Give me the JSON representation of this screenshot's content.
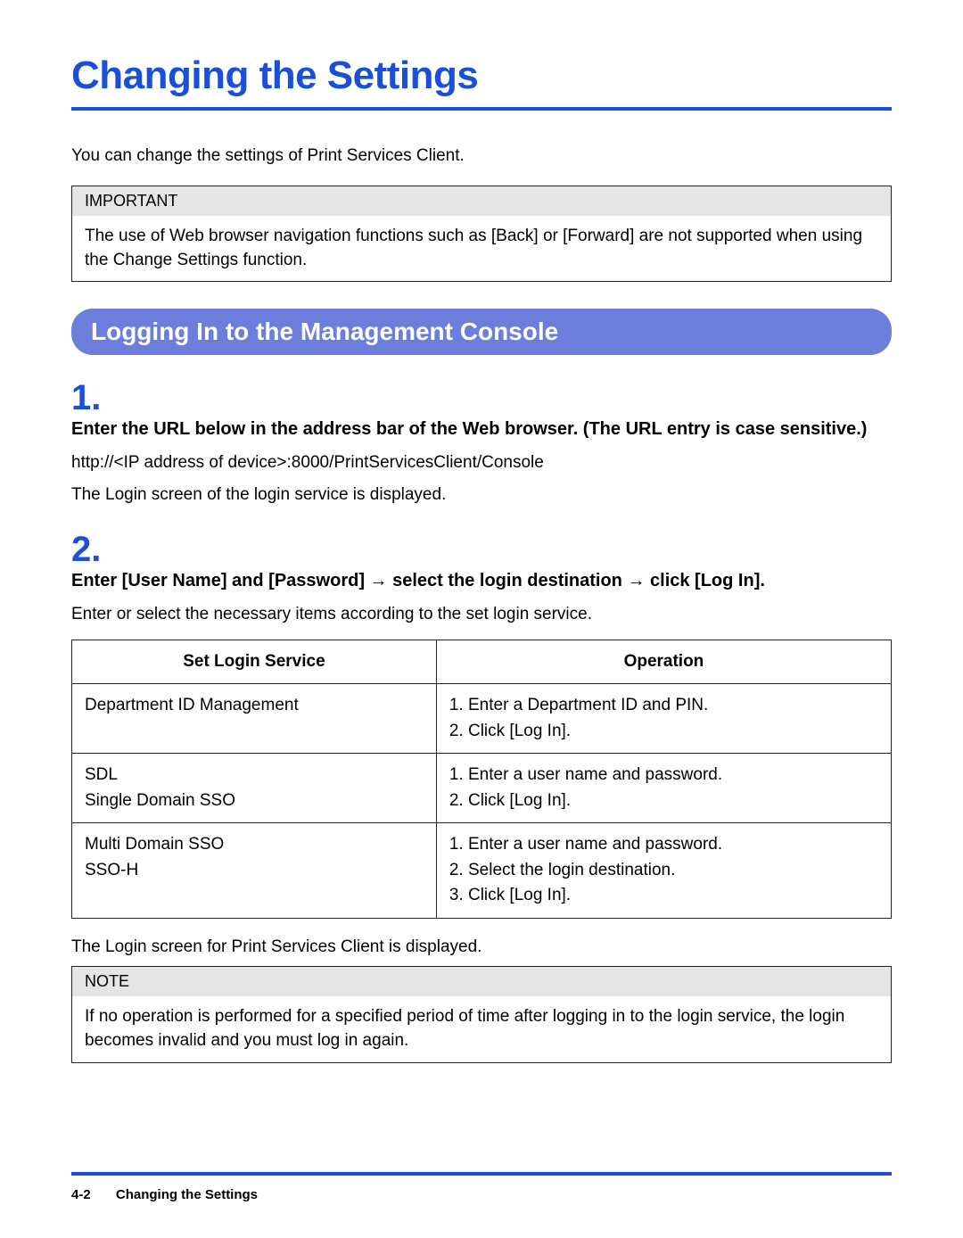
{
  "title": "Changing the Settings",
  "intro": "You can change the settings of Print Services Client.",
  "important": {
    "label": "IMPORTANT",
    "text": "The use of Web browser navigation functions such as [Back] or [Forward] are not supported when using the Change Settings function."
  },
  "section_heading": "Logging In to the Management Console",
  "steps": [
    {
      "num": "1.",
      "head": "Enter the URL below in the address bar of the Web browser. (The URL entry is case sensitive.)",
      "lines": [
        "http://<IP address of device>:8000/PrintServicesClient/Console",
        "The Login screen of the login service is displayed."
      ]
    },
    {
      "num": "2.",
      "head": "Enter [User Name] and [Password] → select the login destination → click [Log In].",
      "lines": [
        "Enter or select the necessary items according to the set login service."
      ]
    }
  ],
  "table": {
    "headers": [
      "Set Login Service",
      "Operation"
    ],
    "rows": [
      {
        "service": [
          "Department ID Management"
        ],
        "operation": [
          "1. Enter a Department ID and PIN.",
          "2. Click [Log In]."
        ]
      },
      {
        "service": [
          "SDL",
          "Single Domain SSO"
        ],
        "operation": [
          "1. Enter a user name and password.",
          "2. Click [Log In]."
        ]
      },
      {
        "service": [
          "Multi Domain SSO",
          "SSO-H"
        ],
        "operation": [
          "1. Enter a user name and password.",
          "2. Select the login destination.",
          "3. Click [Log In]."
        ]
      }
    ]
  },
  "after_table": "The Login screen for Print Services Client is displayed.",
  "note": {
    "label": "NOTE",
    "text": "If no operation is performed for a specified period of time after logging in to the login service, the login becomes invalid and you must log in again."
  },
  "footer": {
    "page": "4-2",
    "title": "Changing the Settings"
  }
}
